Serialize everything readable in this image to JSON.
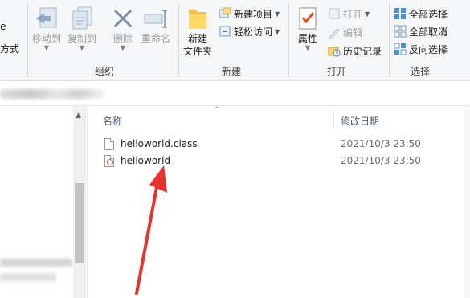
{
  "ribbon": {
    "organize": {
      "label": "组织",
      "shortcut_partial": "方式",
      "shortcut_partial2": "e",
      "move_to": "移动到",
      "copy_to": "复制到",
      "delete": "删除",
      "rename": "重命名"
    },
    "new": {
      "label": "新建",
      "new_folder_line1": "新建",
      "new_folder_line2": "文件夹",
      "new_item": "新建项目",
      "easy_access": "轻松访问"
    },
    "open": {
      "label": "打开",
      "properties": "属性",
      "open": "打开",
      "edit": "编辑",
      "history": "历史记录"
    },
    "select": {
      "label": "选择",
      "select_all": "全部选择",
      "select_none": "全部取消",
      "invert": "反向选择"
    }
  },
  "columns": {
    "name": "名称",
    "date_modified": "修改日期"
  },
  "files": [
    {
      "name": "helloworld.class",
      "date": "2021/10/3 23:50",
      "icon": "blank-file-icon"
    },
    {
      "name": "helloworld",
      "date": "2021/10/3 23:50",
      "icon": "java-file-icon"
    }
  ],
  "annotation": {
    "arrow_color": "#e8322e"
  },
  "colors": {
    "accent": "#1a73d6",
    "header_text": "#4c607a"
  }
}
